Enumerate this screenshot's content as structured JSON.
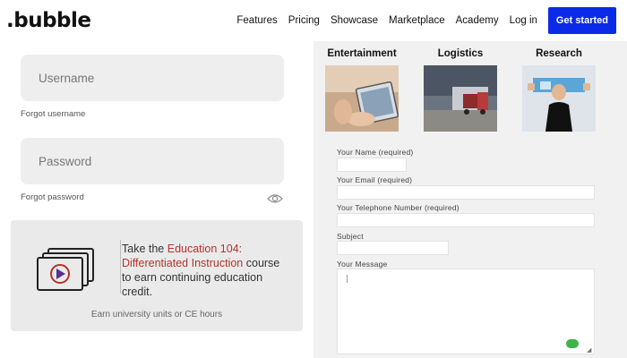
{
  "header": {
    "logo": ".bubble",
    "nav": [
      "Features",
      "Pricing",
      "Showcase",
      "Marketplace",
      "Academy",
      "Log in"
    ],
    "cta": "Get started"
  },
  "login": {
    "username_placeholder": "Username",
    "forgot_username": "Forgot username",
    "password_placeholder": "Password",
    "forgot_password": "Forgot password"
  },
  "promo": {
    "prefix": "Take the ",
    "highlight": "Education 104: Differentiated Instruction",
    "suffix": " course to earn continuing education credit.",
    "footer": "Earn university units or CE hours"
  },
  "categories": [
    "Entertainment",
    "Logistics",
    "Research"
  ],
  "form": {
    "name_label": "Your Name (required)",
    "email_label": "Your Email (required)",
    "phone_label": "Your Telephone Number (required)",
    "subject_label": "Subject",
    "message_label": "Your Message"
  },
  "colors": {
    "cta_bg": "#0b2ae8",
    "highlight": "#b5322a",
    "badge": "#3bb54a",
    "right_bg": "#f1f1f1"
  }
}
